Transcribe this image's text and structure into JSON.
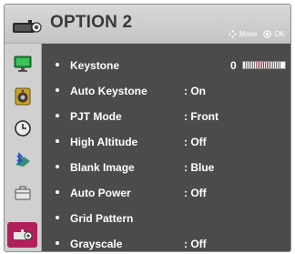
{
  "header": {
    "title": "OPTION 2",
    "hint_move": "Move",
    "hint_ok": "OK"
  },
  "sidebar": {
    "items": [
      {
        "icon": "monitor-icon",
        "active": false
      },
      {
        "icon": "speaker-icon",
        "active": false
      },
      {
        "icon": "clock-icon",
        "active": false
      },
      {
        "icon": "bluetooth-icon",
        "active": false
      },
      {
        "icon": "briefcase-icon",
        "active": false
      },
      {
        "icon": "projector-icon",
        "active": true
      }
    ]
  },
  "menu": {
    "items": [
      {
        "label": "Keystone",
        "value": "",
        "number": "0"
      },
      {
        "label": "Auto Keystone",
        "value": ": On"
      },
      {
        "label": "PJT Mode",
        "value": ": Front"
      },
      {
        "label": "High Altitude",
        "value": ": Off"
      },
      {
        "label": "Blank Image",
        "value": ": Blue"
      },
      {
        "label": "Auto Power",
        "value": ": Off"
      },
      {
        "label": "Grid Pattern",
        "value": ""
      },
      {
        "label": "Grayscale",
        "value": ": Off"
      }
    ]
  },
  "keystone": {
    "value": 0,
    "min": -40,
    "max": 40
  },
  "colors": {
    "accent": "#b0215a",
    "panel": "#4b4b4b",
    "sidebar": "#d0d0d0"
  }
}
